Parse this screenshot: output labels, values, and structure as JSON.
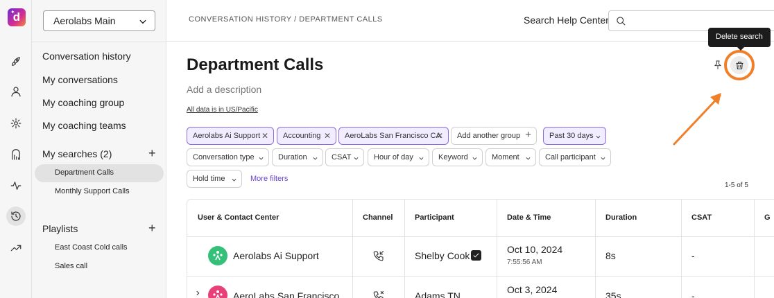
{
  "rail": {
    "logo_letter": "d",
    "icons": [
      "rocket-icon",
      "user-icon",
      "settings-icon",
      "library-icon",
      "activity-icon",
      "history-icon",
      "trending-icon"
    ],
    "active_icon": "history-icon"
  },
  "nav": {
    "workspace": "Aerolabs Main",
    "links": [
      "Conversation history",
      "My conversations",
      "My coaching group",
      "My coaching teams"
    ],
    "searches_label": "My searches (2)",
    "searches": [
      "Department Calls",
      "Monthly Support Calls"
    ],
    "selected_search": "Department Calls",
    "playlists_label": "Playlists",
    "playlists": [
      "East Coast Cold calls",
      "Sales call"
    ]
  },
  "topbar": {
    "breadcrumb": "CONVERSATION HISTORY / DEPARTMENT CALLS",
    "help_label": "Search Help Center:"
  },
  "page": {
    "title": "Department Calls",
    "description_placeholder": "Add a description",
    "timezone_note": "All data is in US/Pacific",
    "tooltip": "Delete search",
    "pin_icon": "pin-icon",
    "delete_icon": "trash-icon",
    "annotation_color": "#f07f2a"
  },
  "filters": {
    "active": [
      "Aerolabs Ai Support",
      "Accounting",
      "AeroLabs San Francisco CA"
    ],
    "add_group": "Add another group",
    "date_range": "Past 30 days",
    "dropdowns": [
      "Conversation type",
      "Duration",
      "CSAT",
      "Hour of day",
      "Keyword",
      "Moment",
      "Call participant",
      "Hold time"
    ],
    "more": "More filters",
    "result_count": "1-5 of 5"
  },
  "table": {
    "columns": [
      "User & Contact Center",
      "Channel",
      "Participant",
      "Date & Time",
      "Duration",
      "CSAT",
      "G"
    ],
    "rows": [
      {
        "user": "Aerolabs Ai Support",
        "channel": "inbound-call-icon",
        "participant": "Shelby Cook",
        "verified": true,
        "date": "Oct 10, 2024",
        "time": "7:55:56 AM",
        "duration": "8s",
        "csat": "-"
      },
      {
        "user": "AeroLabs San Francisco ...",
        "channel": "missed-call-icon",
        "participant": "Adams TN",
        "verified": false,
        "date": "Oct 3, 2024",
        "time": "",
        "duration": "35s",
        "csat": "-"
      }
    ],
    "avatar_colors": [
      "#35c07a",
      "#e8417a"
    ]
  }
}
